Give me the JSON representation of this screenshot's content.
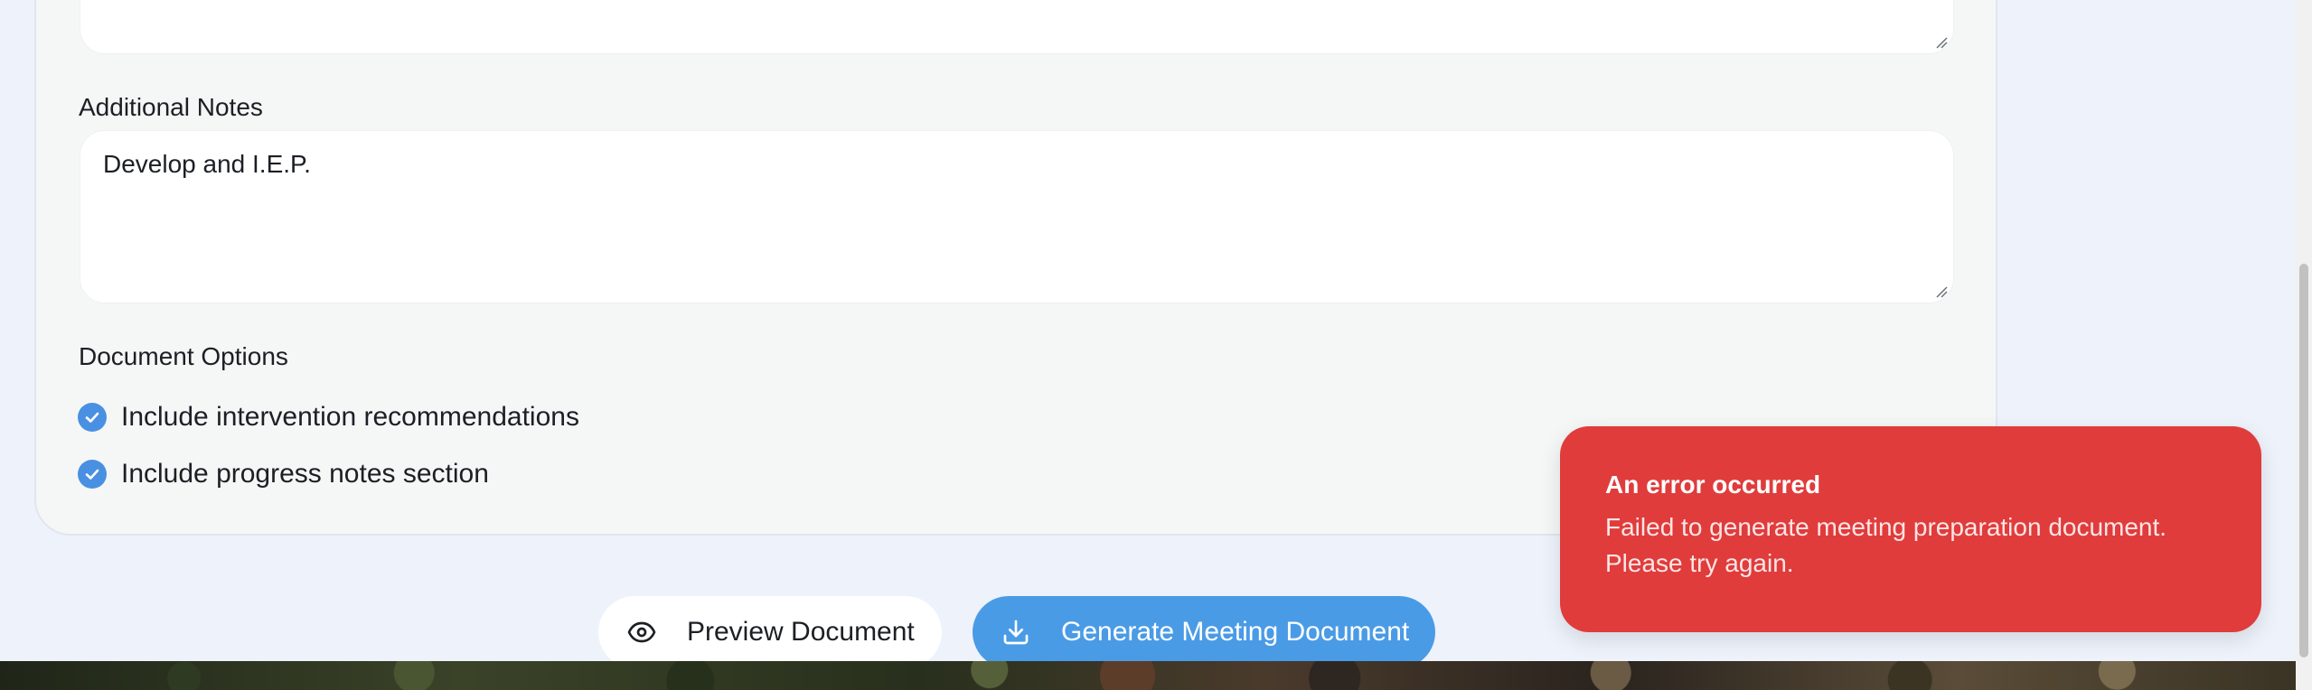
{
  "form": {
    "additional_notes": {
      "label": "Additional Notes",
      "value": "Develop and I.E.P."
    },
    "document_options": {
      "label": "Document Options",
      "options": [
        {
          "label": "Include intervention recommendations",
          "checked": true
        },
        {
          "label": "Include progress notes section",
          "checked": true
        }
      ]
    }
  },
  "actions": {
    "preview_label": "Preview Document",
    "generate_label": "Generate Meeting Document"
  },
  "toast": {
    "title": "An error occurred",
    "message": "Failed to generate meeting preparation document. Please try again."
  },
  "colors": {
    "accent": "#4a9be6",
    "error": "#e03c3c",
    "page_background": "#eef2fb"
  },
  "icons": {
    "checked": "check-circle-icon",
    "preview": "eye-icon",
    "generate": "download-icon"
  }
}
